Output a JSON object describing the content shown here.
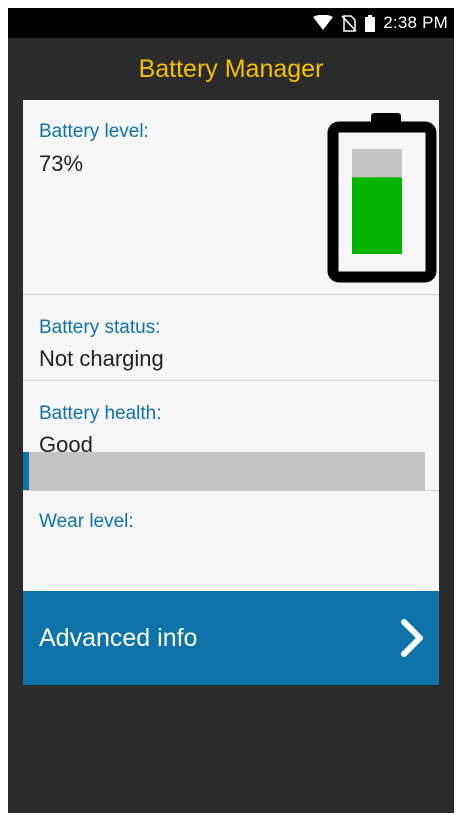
{
  "status_bar": {
    "time": "2:38 PM",
    "icons": [
      "wifi-icon",
      "no-sim-icon",
      "battery-status-icon"
    ]
  },
  "app": {
    "title": "Battery Manager"
  },
  "battery_level": {
    "label": "Battery level:",
    "value": "73%",
    "fill_fraction": 0.73
  },
  "battery_status": {
    "label": "Battery status:",
    "value": "Not charging"
  },
  "battery_health": {
    "label": "Battery health:",
    "value": "Good"
  },
  "wear_level": {
    "label": "Wear level:",
    "fraction": 0.015
  },
  "advanced": {
    "label": "Advanced info",
    "icon": "chevron-right-icon"
  },
  "colors": {
    "accent": "#0e73a8",
    "title": "#f5c000",
    "battery_fill": "#00b400",
    "battery_empty": "#c4c4c4",
    "background": "#2b2b2b"
  }
}
